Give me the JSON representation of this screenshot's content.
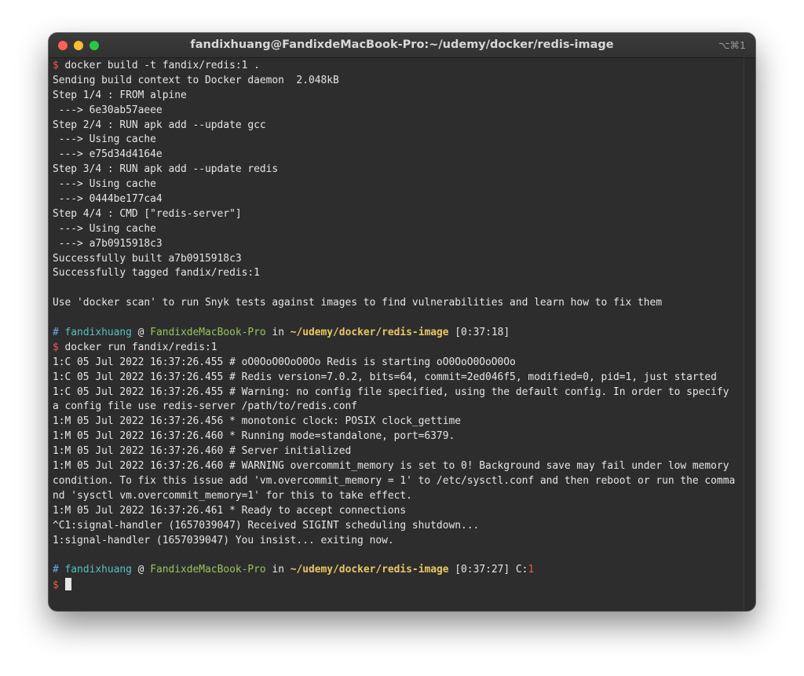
{
  "window": {
    "title": "fandixhuang@FandixdeMacBook-Pro:~/udemy/docker/redis-image",
    "shortcut": "⌥⌘1"
  },
  "colors": {
    "prompt_symbol": "#ee5a52",
    "user": "#56c1c1",
    "host": "#9cc35e",
    "path": "#e9c763",
    "comment_hash": "#6ea8e8",
    "background": "#2d2d2d",
    "foreground": "#e6e6e6"
  },
  "terminal": {
    "lines": [
      {
        "type": "cmd",
        "text": "docker build -t fandix/redis:1 ."
      },
      {
        "type": "out",
        "text": "Sending build context to Docker daemon  2.048kB"
      },
      {
        "type": "out",
        "text": "Step 1/4 : FROM alpine"
      },
      {
        "type": "out",
        "text": " ---> 6e30ab57aeee"
      },
      {
        "type": "out",
        "text": "Step 2/4 : RUN apk add --update gcc"
      },
      {
        "type": "out",
        "text": " ---> Using cache"
      },
      {
        "type": "out",
        "text": " ---> e75d34d4164e"
      },
      {
        "type": "out",
        "text": "Step 3/4 : RUN apk add --update redis"
      },
      {
        "type": "out",
        "text": " ---> Using cache"
      },
      {
        "type": "out",
        "text": " ---> 0444be177ca4"
      },
      {
        "type": "out",
        "text": "Step 4/4 : CMD [\"redis-server\"]"
      },
      {
        "type": "out",
        "text": " ---> Using cache"
      },
      {
        "type": "out",
        "text": " ---> a7b0915918c3"
      },
      {
        "type": "out",
        "text": "Successfully built a7b0915918c3"
      },
      {
        "type": "out",
        "text": "Successfully tagged fandix/redis:1"
      },
      {
        "type": "blank",
        "text": ""
      },
      {
        "type": "out",
        "text": "Use 'docker scan' to run Snyk tests against images to find vulnerabilities and learn how to fix them"
      },
      {
        "type": "blank",
        "text": ""
      },
      {
        "type": "prompt",
        "user": "fandixhuang",
        "host": "FandixdeMacBook-Pro",
        "path": "~/udemy/docker/redis-image",
        "time": "[0:37:18]",
        "extra_label": "",
        "extra_value": ""
      },
      {
        "type": "cmd",
        "text": "docker run fandix/redis:1"
      },
      {
        "type": "out",
        "text": "1:C 05 Jul 2022 16:37:26.455 # oO0OoO0OoO0Oo Redis is starting oO0OoO0OoO0Oo"
      },
      {
        "type": "out",
        "text": "1:C 05 Jul 2022 16:37:26.455 # Redis version=7.0.2, bits=64, commit=2ed046f5, modified=0, pid=1, just started"
      },
      {
        "type": "out",
        "text": "1:C 05 Jul 2022 16:37:26.455 # Warning: no config file specified, using the default config. In order to specify"
      },
      {
        "type": "out",
        "text": "a config file use redis-server /path/to/redis.conf"
      },
      {
        "type": "out",
        "text": "1:M 05 Jul 2022 16:37:26.456 * monotonic clock: POSIX clock_gettime"
      },
      {
        "type": "out",
        "text": "1:M 05 Jul 2022 16:37:26.460 * Running mode=standalone, port=6379."
      },
      {
        "type": "out",
        "text": "1:M 05 Jul 2022 16:37:26.460 # Server initialized"
      },
      {
        "type": "out",
        "text": "1:M 05 Jul 2022 16:37:26.460 # WARNING overcommit_memory is set to 0! Background save may fail under low memory"
      },
      {
        "type": "out",
        "text": "condition. To fix this issue add 'vm.overcommit_memory = 1' to /etc/sysctl.conf and then reboot or run the comma"
      },
      {
        "type": "out",
        "text": "nd 'sysctl vm.overcommit_memory=1' for this to take effect."
      },
      {
        "type": "out",
        "text": "1:M 05 Jul 2022 16:37:26.461 * Ready to accept connections"
      },
      {
        "type": "out",
        "text": "^C1:signal-handler (1657039047) Received SIGINT scheduling shutdown..."
      },
      {
        "type": "out",
        "text": "1:signal-handler (1657039047) You insist... exiting now."
      },
      {
        "type": "blank",
        "text": ""
      },
      {
        "type": "prompt",
        "user": "fandixhuang",
        "host": "FandixdeMacBook-Pro",
        "path": "~/udemy/docker/redis-image",
        "time": "[0:37:27]",
        "extra_label": "C:",
        "extra_value": "1"
      },
      {
        "type": "input",
        "text": ""
      }
    ]
  }
}
